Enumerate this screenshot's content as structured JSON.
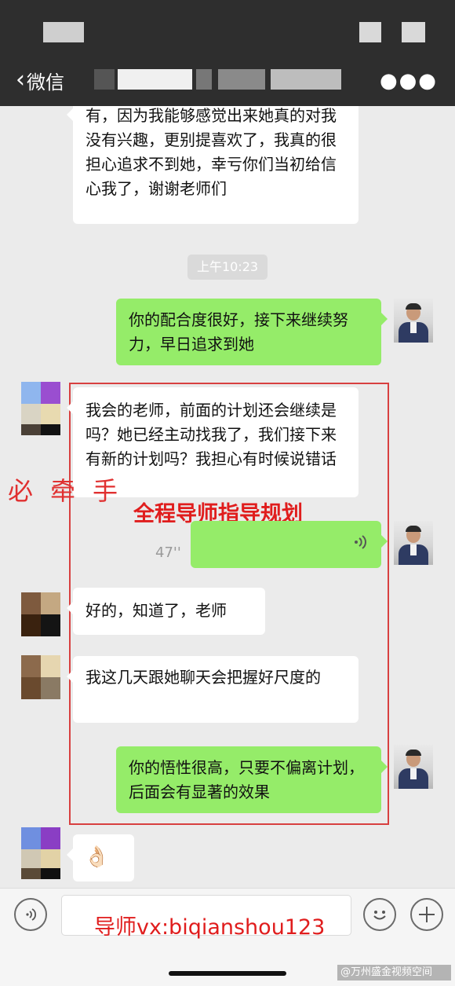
{
  "header": {
    "back_label": "微信",
    "more_icon": "more-dots-icon"
  },
  "messages": {
    "m1": "有，因为我能够感觉出来她真的对我没有兴趣，更别提喜欢了，我真的很担心追求不到她，幸亏你们当初给信心我了，谢谢老师们",
    "timestamp": "上午10:23",
    "m2": "你的配合度很好，接下来继续努力，早日追求到她",
    "m3": "我会的老师，前面的计划还会继续是吗？她已经主动找我了，我们接下来有新的计划吗？我担心有时候说错话",
    "voice_duration": "47''",
    "m4": "好的，知道了，老师",
    "m5": "我这几天跟她聊天会把握好尺度的",
    "m6": "你的悟性很高，只要不偏离计划，后面会有显著的效果",
    "m7": "👌🏻"
  },
  "overlays": {
    "left_watermark": "必牵手",
    "highlight_title": "全程导师指导规划",
    "contact": "导师vx:biqianshou123",
    "corner": "@万州盛金视频空间"
  },
  "input_bar": {
    "voice_icon": "voice-mode-icon",
    "emoji_icon": "emoji-icon",
    "plus_icon": "plus-icon"
  },
  "colors": {
    "header_bg": "#2e2e2e",
    "chat_bg": "#ebebeb",
    "my_bubble": "#95ec69",
    "their_bubble": "#ffffff",
    "overlay_red": "#e01d1d"
  }
}
